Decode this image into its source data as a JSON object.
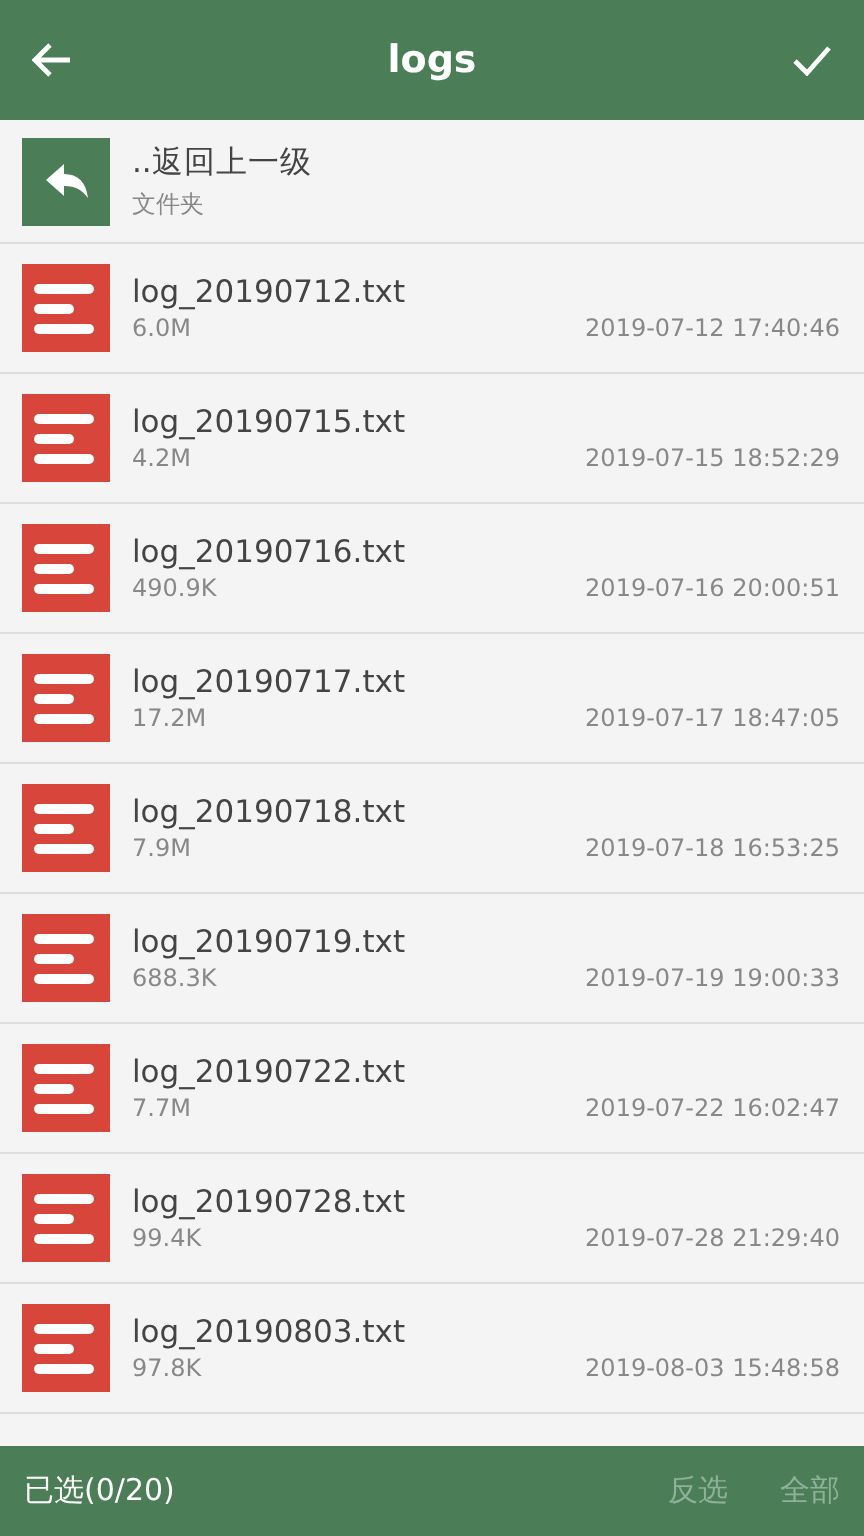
{
  "header": {
    "title": "logs"
  },
  "parent": {
    "name": "..返回上一级",
    "type": "文件夹"
  },
  "files": [
    {
      "name": "log_20190712.txt",
      "size": "6.0M",
      "date": "2019-07-12 17:40:46"
    },
    {
      "name": "log_20190715.txt",
      "size": "4.2M",
      "date": "2019-07-15 18:52:29"
    },
    {
      "name": "log_20190716.txt",
      "size": "490.9K",
      "date": "2019-07-16 20:00:51"
    },
    {
      "name": "log_20190717.txt",
      "size": "17.2M",
      "date": "2019-07-17 18:47:05"
    },
    {
      "name": "log_20190718.txt",
      "size": "7.9M",
      "date": "2019-07-18 16:53:25"
    },
    {
      "name": "log_20190719.txt",
      "size": "688.3K",
      "date": "2019-07-19 19:00:33"
    },
    {
      "name": "log_20190722.txt",
      "size": "7.7M",
      "date": "2019-07-22 16:02:47"
    },
    {
      "name": "log_20190728.txt",
      "size": "99.4K",
      "date": "2019-07-28 21:29:40"
    },
    {
      "name": "log_20190803.txt",
      "size": "97.8K",
      "date": "2019-08-03 15:48:58"
    }
  ],
  "bottom_bar": {
    "selection": "已选(0/20)",
    "buttons": [
      {
        "label": "反选",
        "disabled": true
      },
      {
        "label": "全部",
        "disabled": true
      }
    ]
  }
}
